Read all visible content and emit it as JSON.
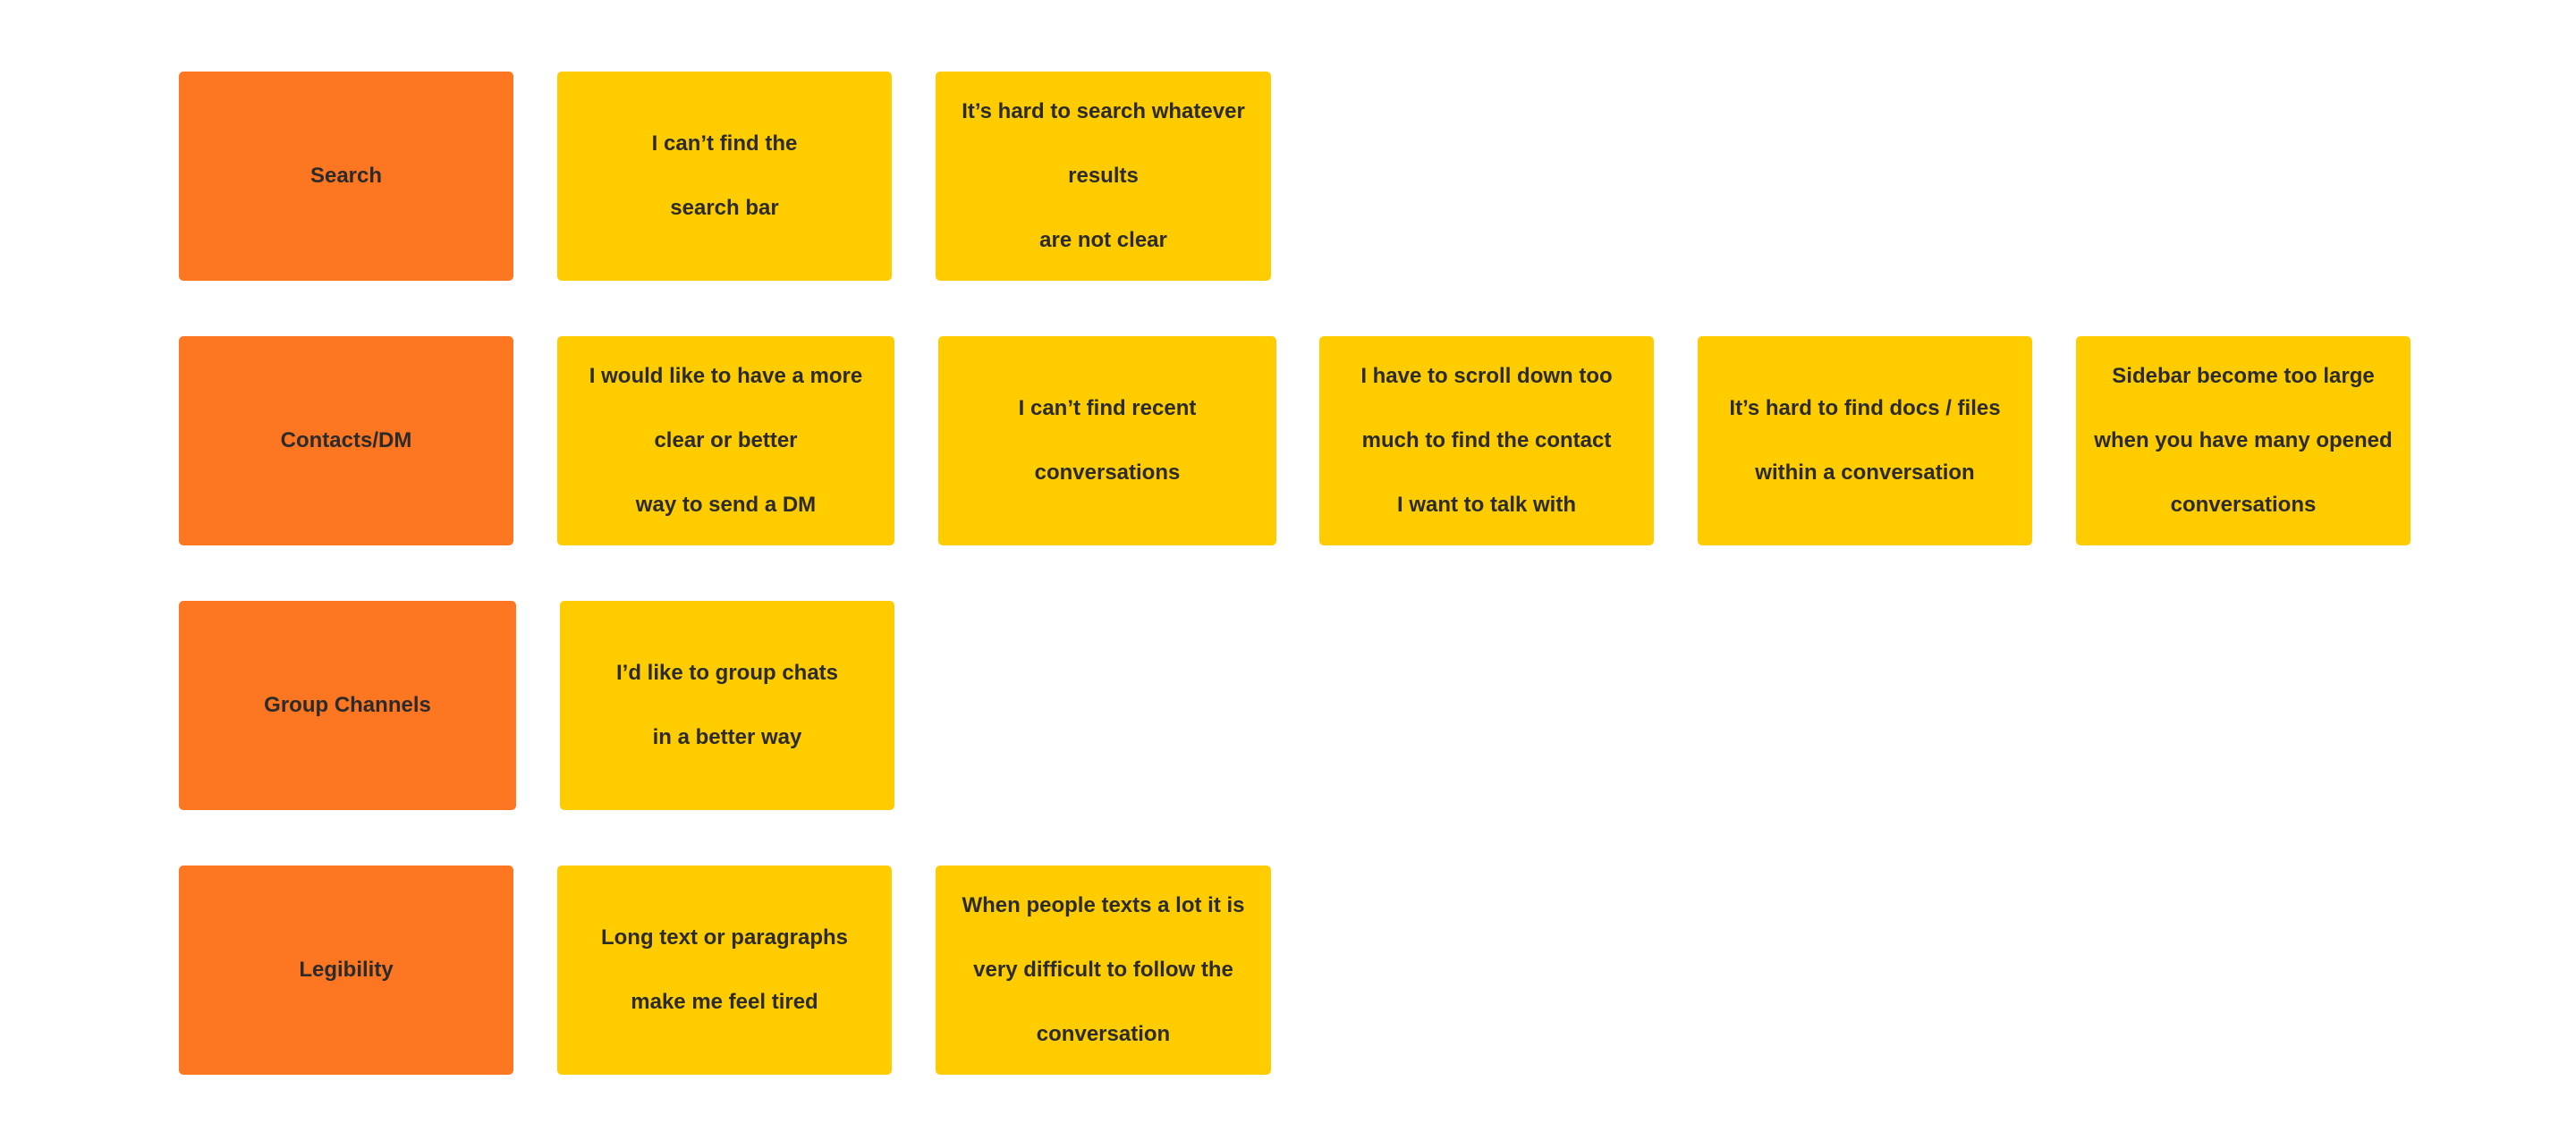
{
  "colors": {
    "category": "#fd7622",
    "sticky": "#ffcc00",
    "text": "#2b2b2b",
    "background": "#ffffff"
  },
  "rows": [
    {
      "category": "Search",
      "notes": [
        [
          "I can’t find the",
          "search bar"
        ],
        [
          "It’s hard to search whatever",
          "results",
          "are not clear"
        ]
      ]
    },
    {
      "category": "Contacts/DM",
      "notes": [
        [
          "I would like to have a more",
          "clear or better",
          "way to send a DM"
        ],
        [
          "I can’t find recent",
          "conversations"
        ],
        [
          "I have to scroll down too",
          "much to find the contact",
          "I want to talk with"
        ],
        [
          "It’s hard to find docs / files",
          "within a conversation"
        ],
        [
          "Sidebar become too large",
          "when you have many opened",
          "conversations"
        ]
      ]
    },
    {
      "category": "Group Channels",
      "notes": [
        [
          "I’d like to group chats",
          "in a better way"
        ]
      ]
    },
    {
      "category": "Legibility",
      "notes": [
        [
          "Long text or paragraphs",
          "make me feel tired"
        ],
        [
          "When people texts a lot it is",
          "very difficult to follow the",
          "conversation"
        ]
      ]
    }
  ]
}
